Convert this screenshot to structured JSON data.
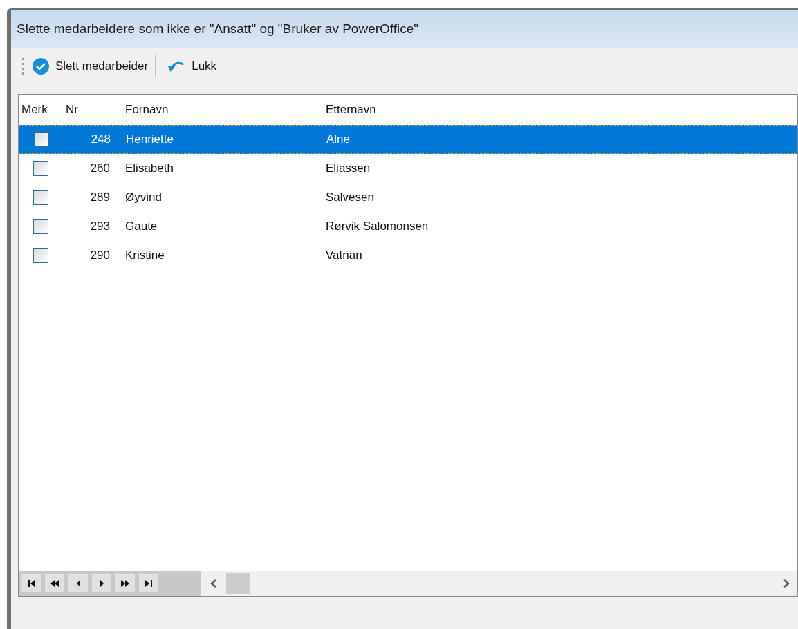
{
  "window": {
    "title": "Slette medarbeidere som ikke er \"Ansatt\" og \"Bruker av PowerOffice\""
  },
  "toolbar": [
    {
      "kind": "delete",
      "label": "Slett medarbeider"
    },
    {
      "kind": "close",
      "label": "Lukk"
    }
  ],
  "table": {
    "columns": [
      "Merk",
      "Nr",
      "Fornavn",
      "Etternavn"
    ],
    "rows": [
      {
        "checked": false,
        "selected": true,
        "nr": "248",
        "first_name": "Henriette",
        "last_name": "Alne"
      },
      {
        "checked": false,
        "selected": false,
        "nr": "260",
        "first_name": "Elisabeth",
        "last_name": "Eliassen"
      },
      {
        "checked": false,
        "selected": false,
        "nr": "289",
        "first_name": "Øyvind",
        "last_name": "Salvesen"
      },
      {
        "checked": false,
        "selected": false,
        "nr": "293",
        "first_name": "Gaute",
        "last_name": "Rørvik Salomonsen"
      },
      {
        "checked": false,
        "selected": false,
        "nr": "290",
        "first_name": "Kristine",
        "last_name": "Vatnan"
      }
    ]
  }
}
